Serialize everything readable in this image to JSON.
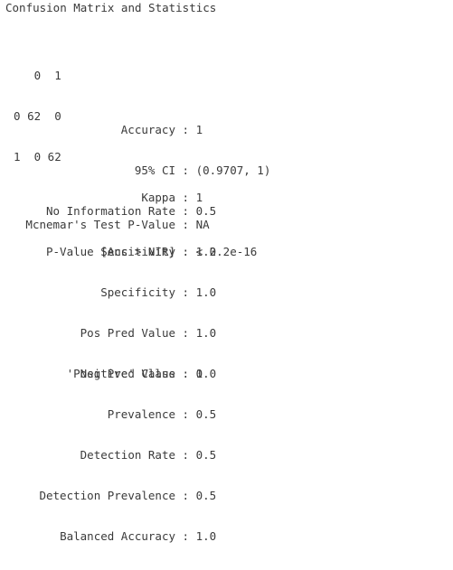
{
  "title": "Confusion Matrix and Statistics",
  "matrix": {
    "header": "     0  1",
    "rows": [
      "  0 62  0",
      "  1  0 62"
    ]
  },
  "stats1": [
    {
      "label": "Accuracy",
      "value": "1"
    },
    {
      "label": "95% CI",
      "value": "(0.9707, 1)"
    },
    {
      "label": "No Information Rate",
      "value": "0.5"
    },
    {
      "label": "P-Value [Acc > NIR]",
      "value": "< 2.2e-16"
    }
  ],
  "kappa": {
    "label": "Kappa",
    "value": "1"
  },
  "mcnemar": {
    "label": "Mcnemar's Test P-Value",
    "value": "NA"
  },
  "stats2": [
    {
      "label": "Sensitivity",
      "value": "1.0"
    },
    {
      "label": "Specificity",
      "value": "1.0"
    },
    {
      "label": "Pos Pred Value",
      "value": "1.0"
    },
    {
      "label": "Neg Pred Value",
      "value": "1.0"
    },
    {
      "label": "Prevalence",
      "value": "0.5"
    },
    {
      "label": "Detection Rate",
      "value": "0.5"
    },
    {
      "label": "Detection Prevalence",
      "value": "0.5"
    },
    {
      "label": "Balanced Accuracy",
      "value": "1.0"
    }
  ],
  "positive_class": {
    "label": "'Positive' Class",
    "value": "0"
  }
}
